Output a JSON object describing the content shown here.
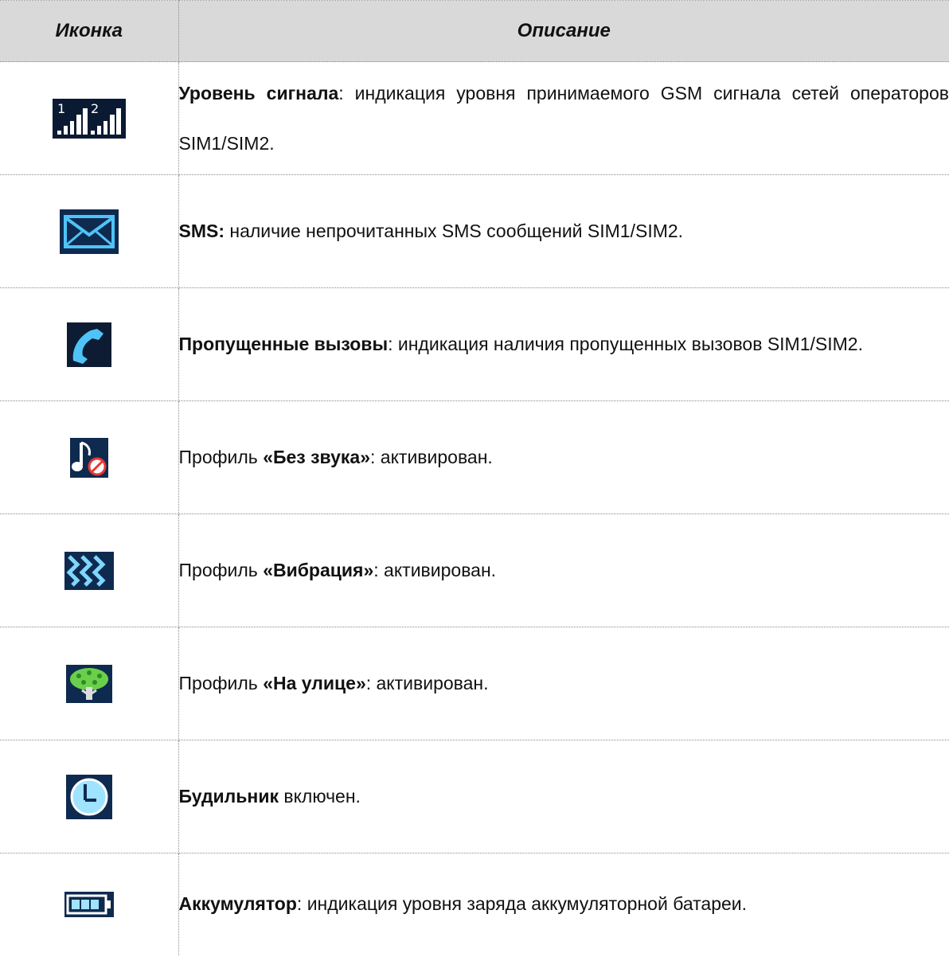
{
  "header": {
    "icon_column": "Иконка",
    "description_column": "Описание"
  },
  "rows": [
    {
      "icon": "signal-strength-icon",
      "bold": "Уровень сигнала",
      "rest": ": индикация уровня принимаемого GSM сигнала сетей операторов SIM1/SIM2.",
      "icon_colors": [
        "#0b1a33",
        "#ffffff"
      ]
    },
    {
      "icon": "sms-envelope-icon",
      "bold": "SMS:",
      "rest": " наличие непрочитанных SMS сообщений SIM1/SIM2.",
      "icon_colors": [
        "#0f2a4f",
        "#4fc3f7"
      ]
    },
    {
      "icon": "missed-call-icon",
      "bold": "Пропущенные вызовы",
      "rest": ": индикация наличия пропущенных вызовов SIM1/SIM2.",
      "icon_colors": [
        "#0d1c33",
        "#4fc3f7"
      ]
    },
    {
      "prefix": "Профиль ",
      "icon": "silent-profile-icon",
      "bold": "«Без звука»",
      "rest": ": активирован.",
      "icon_colors": [
        "#0f2a4f",
        "#e53935"
      ]
    },
    {
      "prefix": "Профиль ",
      "icon": "vibration-profile-icon",
      "bold": "«Вибрация»",
      "rest": ": активирован.",
      "icon_colors": [
        "#0f2a4f",
        "#7fd6ff"
      ]
    },
    {
      "prefix": "Профиль ",
      "icon": "outdoor-profile-icon",
      "bold": "«На улице»",
      "rest": ": активирован.",
      "icon_colors": [
        "#0f2a4f",
        "#6ad04a"
      ]
    },
    {
      "icon": "alarm-clock-icon",
      "bold": "Будильник",
      "rest": " включен.",
      "icon_colors": [
        "#0f2a4f",
        "#9fe3ff"
      ]
    },
    {
      "icon": "battery-icon",
      "bold": "Аккумулятор",
      "rest": ": индикация уровня заряда аккумуляторной батареи.",
      "icon_colors": [
        "#0f2a4f",
        "#9fe3ff"
      ]
    }
  ]
}
